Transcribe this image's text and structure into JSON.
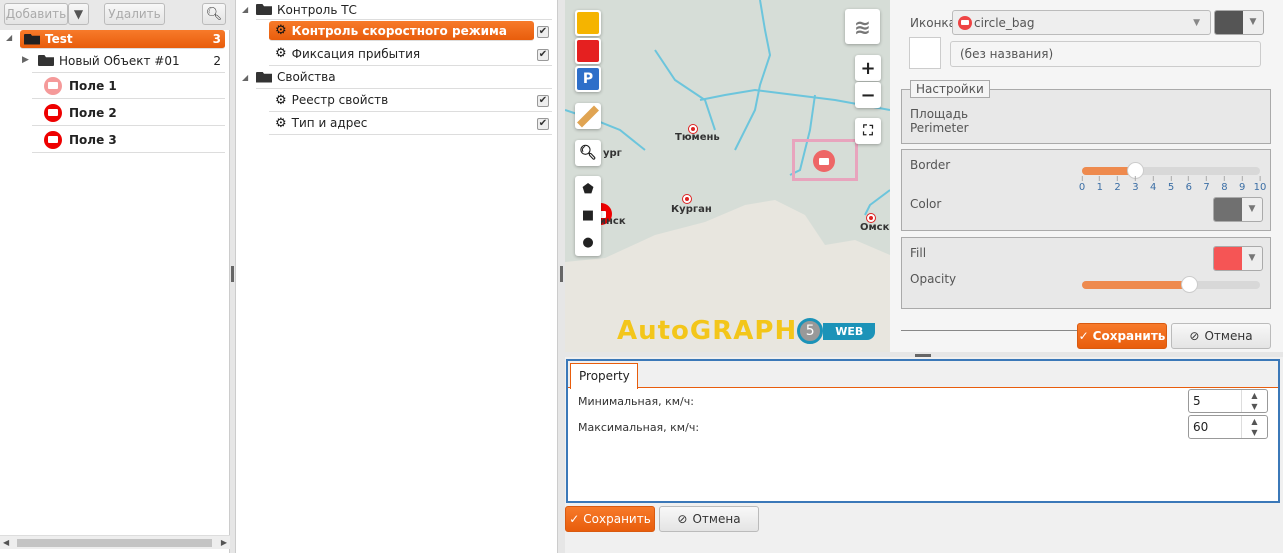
{
  "toolbar": {
    "add": "Добавить",
    "delete": "Удалить"
  },
  "objects_tree": [
    {
      "label": "Test",
      "count": "3"
    },
    {
      "label": "Новый Объект #01",
      "count": "2"
    },
    {
      "label": "Поле 1"
    },
    {
      "label": "Поле 2"
    },
    {
      "label": "Поле 3"
    }
  ],
  "settings_tree": {
    "group1": "Контроль ТС",
    "items1": [
      "Контроль скоростного режима",
      "Фиксация прибытия"
    ],
    "group2": "Свойства",
    "items2": [
      "Реестр свойств",
      "Тип и адрес"
    ]
  },
  "map": {
    "cities": [
      "Тюмень",
      "Курган",
      "Омск",
      "ург",
      "инск"
    ],
    "logo": "AutoGRAPH",
    "logo_version": "5",
    "logo_web": "WEB",
    "zoom_in": "+",
    "zoom_out": "−"
  },
  "style_panel": {
    "icon_label": "Иконка",
    "icon_value": "circle_bag",
    "icon_color": "#555555",
    "name_placeholder": "(без названия)",
    "settings_legend": "Настройки",
    "area": "Площадь",
    "perimeter": "Perimeter",
    "border_label": "Border",
    "border_value": 3,
    "border_ticks": [
      "0",
      "1",
      "2",
      "3",
      "4",
      "5",
      "6",
      "7",
      "8",
      "9",
      "10"
    ],
    "color_label": "Color",
    "border_color": "#707070",
    "fill_label": "Fill",
    "fill_color": "#f55555",
    "opacity_label": "Opacity",
    "opacity_value": 0.6,
    "save": "Сохранить",
    "cancel": "Отмена"
  },
  "property": {
    "tab": "Property",
    "min_label": "Минимальная, км/ч:",
    "min_value": "5",
    "max_label": "Максимальная, км/ч:",
    "max_value": "60",
    "save": "Сохранить",
    "cancel": "Отмена"
  }
}
